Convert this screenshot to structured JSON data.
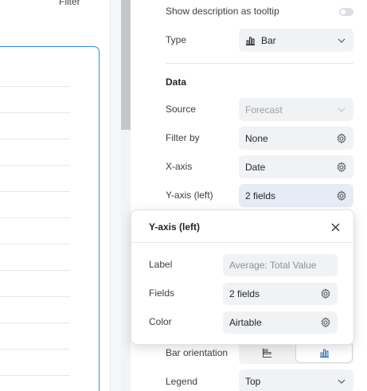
{
  "canvas": {
    "filter_label": "Filter"
  },
  "settings": {
    "show_description_label": "Show description as tooltip",
    "type_label": "Type",
    "type_value": "Bar",
    "data_section": "Data",
    "source_label": "Source",
    "source_value": "Forecast",
    "filter_label": "Filter by",
    "filter_value": "None",
    "xaxis_label": "X-axis",
    "xaxis_value": "Date",
    "yaxis_label": "Y-axis (left)",
    "yaxis_value": "2 fields",
    "bar_orientation_label": "Bar orientation",
    "legend_label": "Legend",
    "legend_value": "Top"
  },
  "popover": {
    "title": "Y-axis (left)",
    "label_label": "Label",
    "label_placeholder": "Average: Total Value",
    "fields_label": "Fields",
    "fields_value": "2 fields",
    "color_label": "Color",
    "color_value": "Airtable"
  },
  "colors": {
    "accent": "#2d8fd0",
    "field_bg": "#f1f2f4"
  }
}
